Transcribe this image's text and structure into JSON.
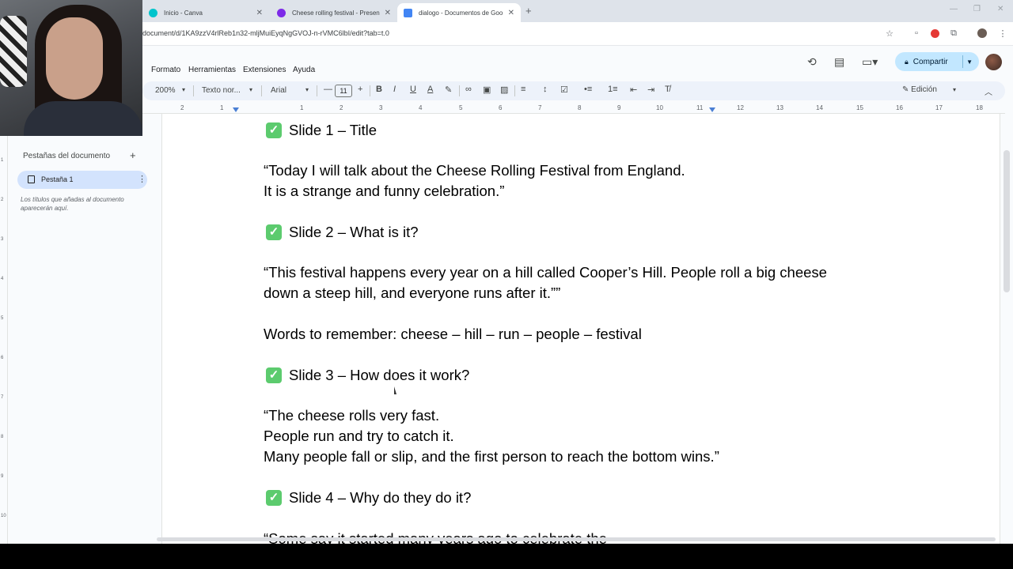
{
  "browser": {
    "tabs": [
      {
        "title": "Inicio - Canva",
        "color": "#00c4cc"
      },
      {
        "title": "Cheese rolling festival - Presen",
        "color": "#7d2ae8"
      },
      {
        "title": "dialogo - Documentos de Goo",
        "color": "#4285f4"
      }
    ],
    "url": "document/d/1KA9zzV4rlReb1n32-mljMuiEyqNgGVOJ-n-rVMC6lbI/edit?tab=t.0"
  },
  "docs": {
    "menu": [
      "Formato",
      "Herramientas",
      "Extensiones",
      "Ayuda"
    ],
    "share_label": "Compartir",
    "toolbar": {
      "zoom": "200%",
      "style": "Texto nor...",
      "font": "Arial",
      "font_size": "11",
      "mode": "Edición"
    },
    "ruler_numbers": [
      "2",
      "1",
      "1",
      "2",
      "3",
      "4",
      "5",
      "6",
      "7",
      "8",
      "9",
      "10",
      "11",
      "12",
      "13",
      "14",
      "15",
      "16",
      "17",
      "18"
    ],
    "vruler_numbers": [
      "1",
      "2",
      "3",
      "4",
      "5",
      "6",
      "7",
      "8",
      "9",
      "10"
    ]
  },
  "sidepanel": {
    "title": "Pestañas del documento",
    "tab_label": "Pestaña 1",
    "note": "Los títulos que añadas al documento aparecerán aquí."
  },
  "document": {
    "slide1_heading": "Slide 1 – Title",
    "slide1_line1": "“Today I will talk about the Cheese Rolling Festival from England.",
    "slide1_line2": "It is a strange and funny celebration.”",
    "slide2_heading": "Slide 2 – What is it?",
    "slide2_line1": "“This festival happens every year on a hill called Cooper’s Hill. People roll a big cheese",
    "slide2_line2": "down a steep hill, and everyone runs after it.””",
    "words": "Words to remember: cheese – hill – run – people – festival",
    "slide3_heading": "Slide 3 – How does it work?",
    "slide3_line1": "“The cheese rolls very fast.",
    "slide3_line2": "People run and try to catch it.",
    "slide3_line3": "Many people fall or slip, and the first person to reach the bottom wins.”",
    "slide4_heading": "Slide 4 – Why do they do it?",
    "slide4_partial": "“Some say it started many years ago to celebrate the"
  },
  "icons": {
    "check": "✓"
  }
}
